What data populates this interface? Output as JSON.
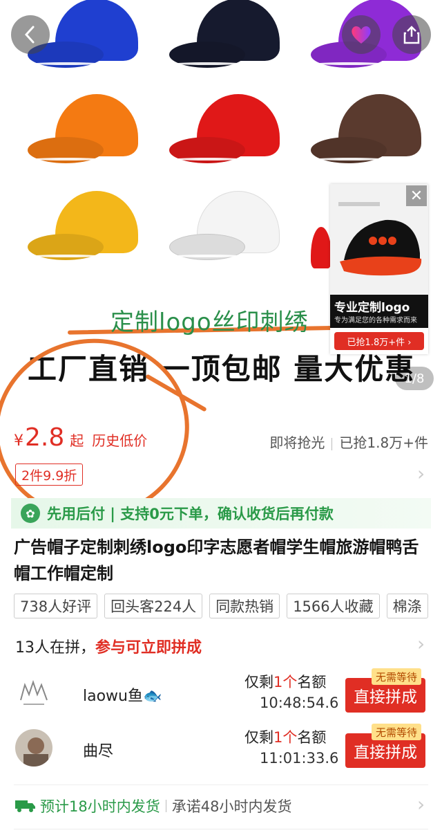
{
  "hero": {
    "caption_line1": "定制logo丝印刺绣",
    "caption_line2": "工厂直销 一顶包邮 量大优惠",
    "page_counter": "1/8",
    "ad": {
      "title": "专业定制logo",
      "subtitle": "专为满足您的各种需求而来",
      "grabbed": "已抢1.8万+件 ›"
    },
    "cap_colors": [
      "#1f3fd0",
      "#161a2e",
      "#8e2bd6",
      "#f47a12",
      "#e01818",
      "#5a3a2e",
      "#f3b71a",
      "#f4f4f4",
      "#e01818"
    ]
  },
  "price": {
    "symbol": "¥",
    "value": "2.8",
    "qi": "起",
    "history": "历史低价",
    "soon_sold_out": "即将抢光",
    "grabbed": "已抢1.8万+件",
    "discount": "2件9.9折"
  },
  "paylater": {
    "text": "先用后付 | 支持0元下单，确认收货后再付款"
  },
  "title": "广告帽子定制刺绣logo印字志愿者帽学生帽旅游帽鸭舌帽工作帽定制",
  "tags": [
    "738人好评",
    "回头客224人",
    "同款热销",
    "1566人收藏",
    "棉涤"
  ],
  "group": {
    "head_prefix": "13人在拼，",
    "head_highlight": "参与可立即拼成",
    "rows": [
      {
        "name": "laowu鱼🐟",
        "remain_prefix": "仅剩",
        "remain_num": "1个",
        "remain_suffix": "名额",
        "time": "10:48:54.6",
        "button": "直接拼成",
        "badge": "无需等待"
      },
      {
        "name": "曲尽",
        "remain_prefix": "仅剩",
        "remain_num": "1个",
        "remain_suffix": "名额",
        "time": "11:01:33.6",
        "button": "直接拼成",
        "badge": "无需等待"
      }
    ]
  },
  "shipping": {
    "green": "预计18小时内发货",
    "grey": "承诺48小时内发货"
  },
  "colors": {
    "accent_red": "#e02e24",
    "green": "#2a9a48",
    "annotation_orange": "#e8742e"
  }
}
